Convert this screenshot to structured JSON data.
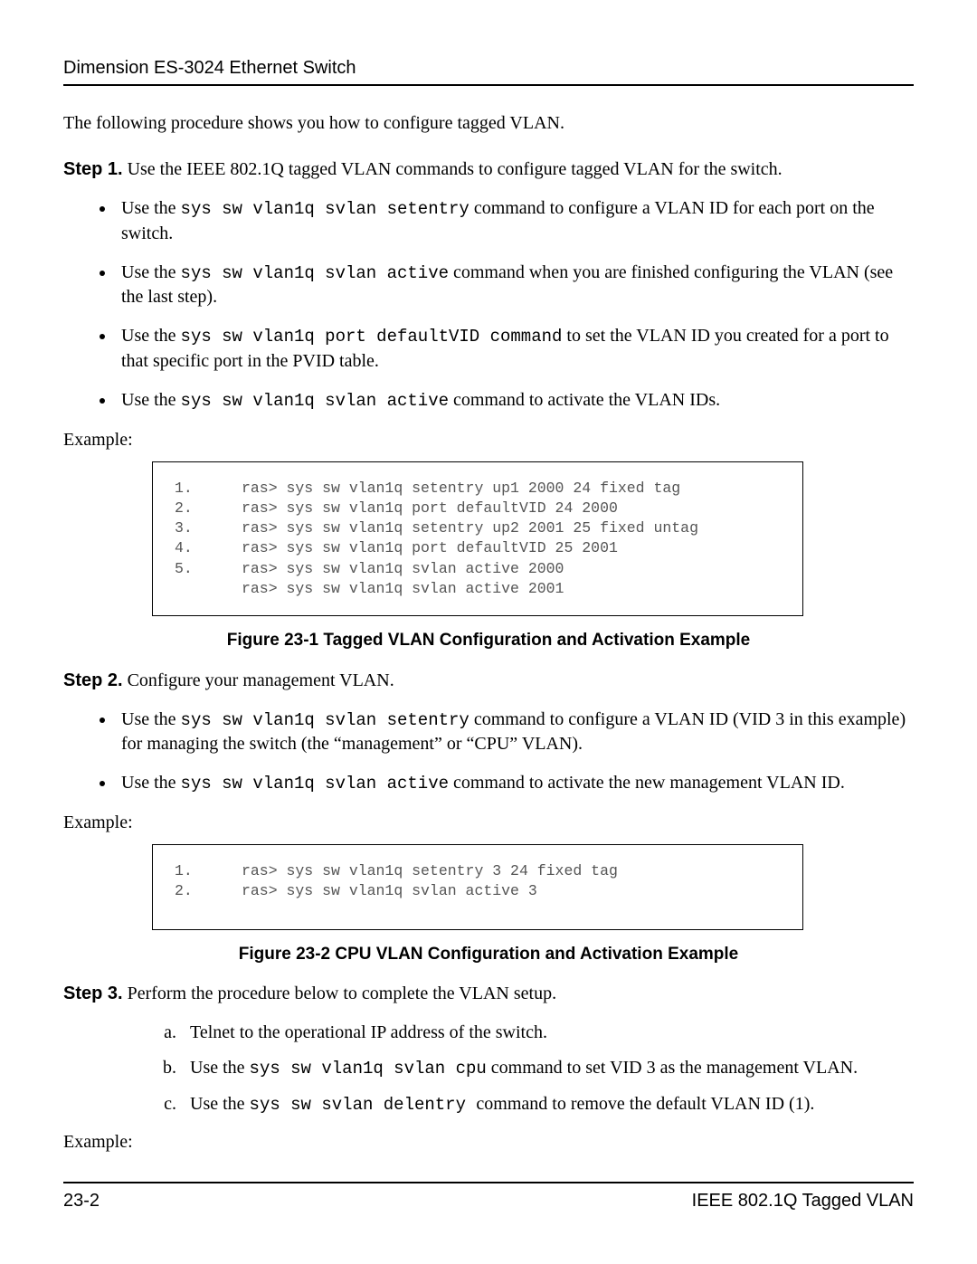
{
  "header": {
    "title": "Dimension ES-3024 Ethernet Switch"
  },
  "intro": "The following procedure shows you how to configure tagged VLAN.",
  "step1": {
    "label": "Step 1.",
    "text": " Use the IEEE 802.1Q tagged VLAN commands to configure tagged VLAN for the switch.",
    "bullets": [
      {
        "pre": "Use the ",
        "code": "sys sw vlan1q svlan setentry",
        "post": " command to configure a VLAN ID for each port on the switch."
      },
      {
        "pre": "Use the ",
        "code": "sys sw vlan1q svlan active",
        "post": " command when you are finished configuring the VLAN (see the last step)."
      },
      {
        "pre": "Use the ",
        "code": "sys sw vlan1q port defaultVID command",
        "post": " to set the VLAN ID you created for a port to that specific port in the PVID table."
      },
      {
        "pre": "Use the ",
        "code": "sys sw vlan1q svlan active",
        "post": " command to activate the VLAN IDs."
      }
    ],
    "example_label": "Example:",
    "code": [
      {
        "n": "1.",
        "c": "ras> sys sw vlan1q setentry up1 2000 24 fixed tag"
      },
      {
        "n": "2.",
        "c": "ras> sys sw vlan1q port defaultVID 24 2000"
      },
      {
        "n": "3.",
        "c": "ras> sys sw vlan1q setentry up2 2001 25 fixed untag"
      },
      {
        "n": "4.",
        "c": "ras> sys sw vlan1q port defaultVID 25 2001"
      },
      {
        "n": "5.",
        "c": "ras> sys sw vlan1q svlan active 2000"
      },
      {
        "n": "",
        "c": "ras> sys sw vlan1q svlan active 2001"
      }
    ],
    "figure": "Figure 23-1 Tagged VLAN Configuration and Activation Example"
  },
  "step2": {
    "label": "Step 2.",
    "text": " Configure your management VLAN.",
    "bullets": [
      {
        "pre": "Use the ",
        "code": "sys sw vlan1q svlan setentry",
        "post": " command to configure a VLAN ID (VID 3 in this example) for managing the switch (the “management” or “CPU” VLAN)."
      },
      {
        "pre": "Use the ",
        "code": "sys sw vlan1q svlan active",
        "post": " command to activate the new management VLAN ID."
      }
    ],
    "example_label": "Example:",
    "code": [
      {
        "n": "1.",
        "c": "ras> sys sw vlan1q setentry 3 24 fixed tag"
      },
      {
        "n": "2.",
        "c": "ras> sys sw vlan1q svlan active 3"
      }
    ],
    "figure": "Figure 23-2 CPU VLAN Configuration and Activation Example"
  },
  "step3": {
    "label": "Step 3.",
    "text": " Perform the procedure below to complete the VLAN setup.",
    "items": [
      {
        "pre": "Telnet to the operational IP address of the switch.",
        "code": "",
        "post": ""
      },
      {
        "pre": "Use the ",
        "code": "sys sw vlan1q svlan cpu",
        "post": " command to set VID 3 as the management VLAN."
      },
      {
        "pre": "Use the ",
        "code": "sys sw svlan delentry ",
        "post": " command to remove the default VLAN ID (1)."
      }
    ],
    "example_label": "Example:"
  },
  "footer": {
    "left": "23-2",
    "right": "IEEE 802.1Q Tagged VLAN"
  }
}
